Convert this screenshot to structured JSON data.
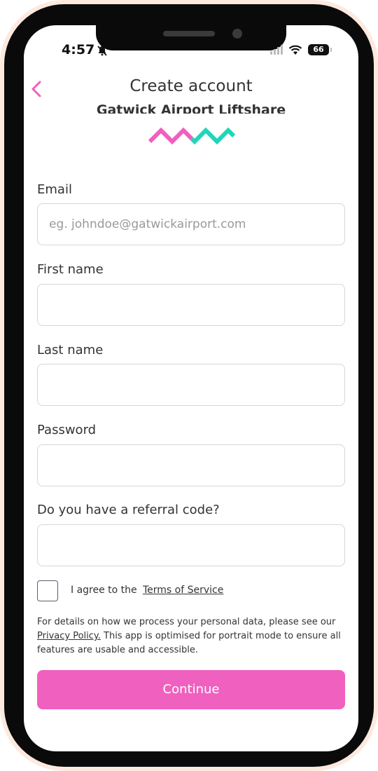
{
  "status_bar": {
    "time": "4:57",
    "battery": "66"
  },
  "header": {
    "title": "Create account",
    "brand_name": "Gatwick Airport Liftshare"
  },
  "colors": {
    "accent_pink": "#f060be",
    "logo_pink": "#f05fc0",
    "logo_teal": "#1fd6b8"
  },
  "form": {
    "email": {
      "label": "Email",
      "placeholder": "eg. johndoe@gatwickairport.com",
      "value": ""
    },
    "first_name": {
      "label": "First name",
      "value": ""
    },
    "last_name": {
      "label": "Last name",
      "value": ""
    },
    "password": {
      "label": "Password",
      "value": ""
    },
    "referral": {
      "label": "Do you have a referral code?",
      "value": ""
    }
  },
  "terms": {
    "agree_text": "I agree to the",
    "link_text": "Terms of Service",
    "checked": false
  },
  "privacy": {
    "before": "For details on how we process your personal data, please see our ",
    "link_text": "Privacy Policy.",
    "after": " This app is optimised for portrait mode to ensure all features are usable and accessible."
  },
  "continue_button": "Continue"
}
